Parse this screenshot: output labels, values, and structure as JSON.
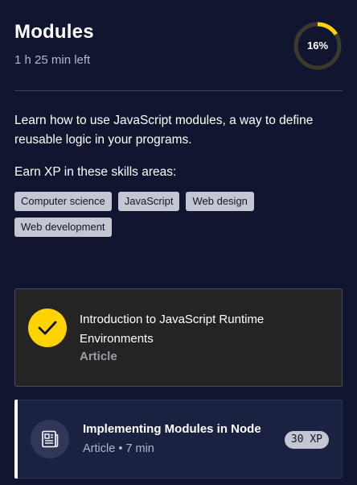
{
  "module": {
    "title": "Modules",
    "time_left": "1 h 25 min left",
    "progress_label": "16%",
    "progress_fraction": 0.16,
    "description": "Learn how to use JavaScript modules, a way to define reusable logic in your programs.",
    "skills_heading": "Earn XP in these skills areas:",
    "skills": [
      "Computer science",
      "JavaScript",
      "Web design",
      "Web development"
    ]
  },
  "lessons": [
    {
      "title": "Introduction to JavaScript Runtime Environments",
      "type": "Article",
      "status": "completed",
      "icon": "check-icon"
    },
    {
      "title": "Implementing Modules in Node",
      "meta": "Article • 7 min",
      "xp": "30 XP",
      "status": "current",
      "icon": "article-icon"
    }
  ],
  "colors": {
    "background": "#10162f",
    "accent": "#ffd300",
    "tag": "#c4c7d1",
    "completed_card": "#242424",
    "current_card": "#1b2140"
  }
}
